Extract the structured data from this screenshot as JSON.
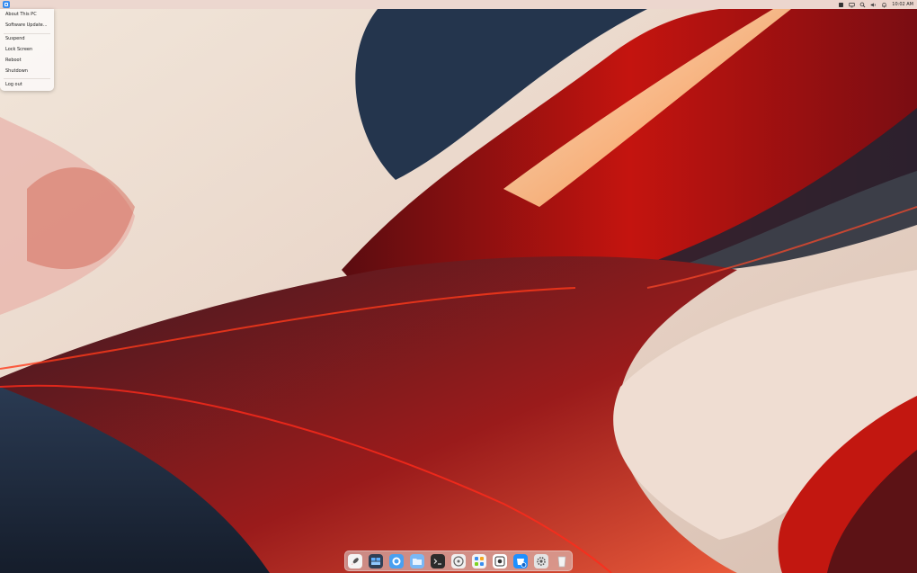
{
  "topbar": {
    "clock": "10:02 AM",
    "tray_icons": [
      "app-indicator-icon",
      "monitor-icon",
      "search-icon",
      "volume-icon",
      "notification-bell-icon"
    ]
  },
  "system_menu": {
    "items": [
      {
        "id": "about",
        "label": "About This PC"
      },
      {
        "id": "update",
        "label": "Software Update..."
      },
      {
        "id": "suspend",
        "label": "Suspend"
      },
      {
        "id": "lock",
        "label": "Lock Screen"
      },
      {
        "id": "reboot",
        "label": "Reboot"
      },
      {
        "id": "shutdown",
        "label": "Shutdown"
      },
      {
        "id": "logout",
        "label": "Log out"
      }
    ]
  },
  "dock": {
    "apps": [
      {
        "name": "launchpad-rocket-icon"
      },
      {
        "name": "multitasking-view-icon"
      },
      {
        "name": "browser-icon"
      },
      {
        "name": "file-manager-icon"
      },
      {
        "name": "terminal-icon"
      },
      {
        "name": "system-monitor-icon"
      },
      {
        "name": "app-store-icon"
      },
      {
        "name": "screenshot-icon"
      },
      {
        "name": "software-center-icon"
      },
      {
        "name": "settings-icon"
      },
      {
        "name": "trash-icon"
      }
    ]
  },
  "colors": {
    "accent": "#3a8ef0",
    "wallpaper_red": "#d51a12",
    "wallpaper_cream": "#efe3d6",
    "wallpaper_navy": "#1d2a3c"
  }
}
